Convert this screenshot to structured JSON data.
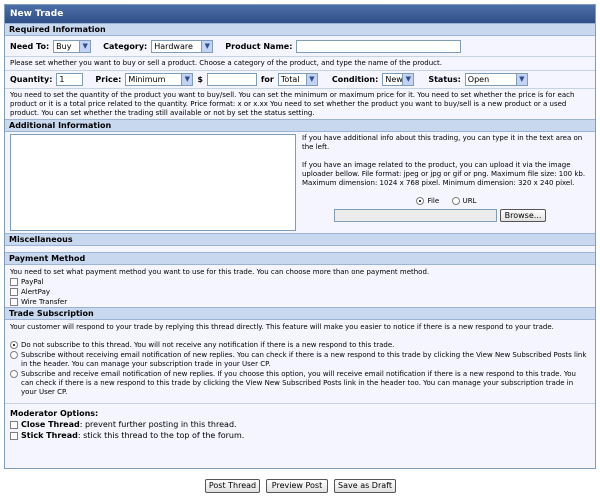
{
  "window": {
    "title": "New Trade"
  },
  "required": {
    "heading": "Required Information",
    "need_to_label": "Need To:",
    "need_to_value": "Buy",
    "category_label": "Category:",
    "category_value": "Hardware",
    "product_name_label": "Product Name:",
    "product_name_value": "",
    "help1": "Please set whether you want to buy or sell a product. Choose a category of the product, and type the name of the product.",
    "quantity_label": "Quantity:",
    "quantity_value": "1",
    "price_label": "Price:",
    "price_type_value": "Minimum",
    "currency": "$",
    "price_value": "",
    "for_label": "for",
    "for_value": "Total",
    "condition_label": "Condition:",
    "condition_value": "New",
    "status_label": "Status:",
    "status_value": "Open",
    "help2": "You need to set the quantity of the product you want to buy/sell. You can set the minimum or maximum price for it. You need to set whether the price is for each product or it is a total price related to the quantity. Price format: x or x.xx You need to set whether the product you want to buy/sell is a new product or a used product. You can set whether the trading still available or not by set the status setting."
  },
  "additional": {
    "heading": "Additional Information",
    "text_value": "",
    "info1": "If you have additional info about this trading, you can type it in the text area on the left.",
    "info2": "If you have an image related to the product, you can upload it via the image uploader bellow. File format: jpeg or jpg or gif or png. Maximum file size: 100 kb. Maximum dimension: 1024 x 768 pixel. Minimum dimension: 320 x 240 pixel.",
    "file_option": "File",
    "url_option": "URL",
    "file_value": "",
    "browse_label": "Browse..."
  },
  "misc": {
    "heading": "Miscellaneous"
  },
  "payment": {
    "heading": "Payment Method",
    "help": "You need to set what payment method you want to use for this trade. You can choose more than one payment method.",
    "options": [
      "PayPal",
      "AlertPay",
      "Wire Transfer"
    ]
  },
  "subscription": {
    "heading": "Trade Subscription",
    "help": "Your customer will respond to your trade by replying this thread directly. This feature will make you easier to notice if there is a new respond to your trade.",
    "opt1": "Do not subscribe to this thread. You will not receive any notification if there is a new respond to this trade.",
    "opt2": "Subscribe without receiving email notification of new replies. You can check if there is a new respond to this trade by clicking the View New Subscribed Posts link in the header. You can manage your subscription trade in your User CP.",
    "opt3": "Subscribe and receive email notification of new replies. If you choose this option, you will receive email notification if there is a new respond to this trade. You can check if there is a new respond to this trade by clicking the View New Subscribed Posts link in the header too. You can manage your subscription trade in your User CP."
  },
  "moderator": {
    "heading": "Moderator Options:",
    "close_label": "Close Thread",
    "close_desc": ": prevent further posting in this thread.",
    "stick_label": "Stick Thread",
    "stick_desc": ": stick this thread to the top of the forum."
  },
  "actions": {
    "post": "Post Thread",
    "preview": "Preview Post",
    "draft": "Save as Draft"
  },
  "colors": {
    "title_bar": "#2f4f89",
    "section_head": "#c8d8ef",
    "panel": "#f5f5ff",
    "border": "#7f9db9"
  }
}
